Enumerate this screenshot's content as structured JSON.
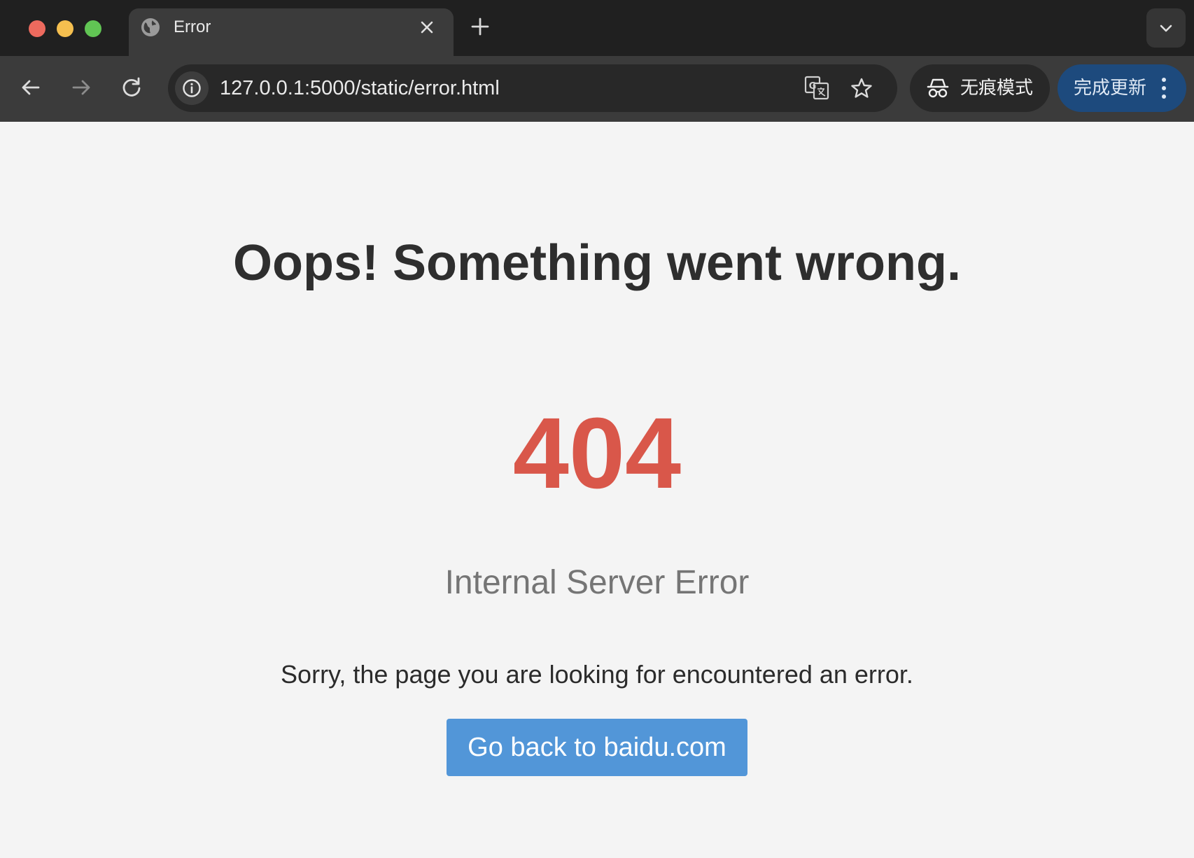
{
  "window": {
    "traffic_lights": {
      "close_color": "#ed6a5e",
      "minimize_color": "#f5bf4f",
      "zoom_color": "#61c554"
    }
  },
  "tab": {
    "title": "Error",
    "icon": "globe-icon",
    "close_icon": "close-icon"
  },
  "tabstrip": {
    "new_tab_icon": "plus-icon",
    "tab_search_icon": "chevron-down-icon"
  },
  "toolbar": {
    "back_icon": "arrow-left-icon",
    "forward_icon": "arrow-right-icon",
    "reload_icon": "reload-icon",
    "address": {
      "url": "127.0.0.1:5000/static/error.html",
      "site_info_icon": "info-icon"
    },
    "translate_icon": "translate-icon",
    "bookmark_icon": "star-icon",
    "incognito": {
      "label": "无痕模式",
      "icon": "incognito-icon"
    },
    "update": {
      "label": "完成更新",
      "menu_icon": "more-vertical-icon",
      "color": "#1d4a7d"
    }
  },
  "page": {
    "headline": "Oops! Something went wrong.",
    "status_code": "404",
    "status_color": "#d9574a",
    "reason": "Internal Server Error",
    "message": "Sorry, the page you are looking for encountered an error.",
    "back_button": {
      "label": "Go back to baidu.com",
      "color": "#5296d8"
    }
  }
}
